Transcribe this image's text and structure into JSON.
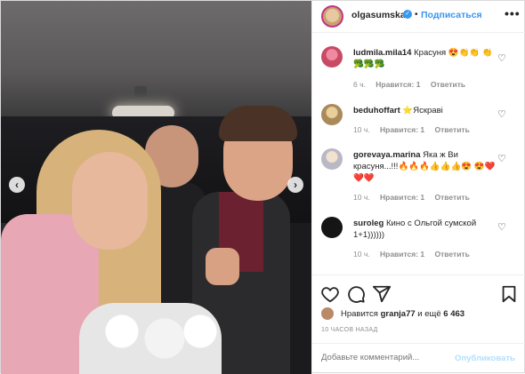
{
  "header": {
    "username": "olgasumska",
    "separator": "•",
    "follow_label": "Подписаться",
    "more_label": "•••"
  },
  "photo": {
    "prev_arrow": "‹",
    "next_arrow": "›"
  },
  "comments": [
    {
      "user": "ludmila.mila14",
      "text": "Красуня 😍👏👏 👏🥦🥦🥦",
      "time": "6 ч.",
      "likes": "Нравится: 1",
      "reply": "Ответить"
    },
    {
      "user": "beduhoffart",
      "text": "⭐Яскраві",
      "time": "10 ч.",
      "likes": "Нравится: 1",
      "reply": "Ответить"
    },
    {
      "user": "gorevaya.marina",
      "text": "Яка ж Ви красуня...!!!🔥🔥🔥👍👍👍😍 😍❤️❤️❤️",
      "time": "10 ч.",
      "likes": "Нравится: 1",
      "reply": "Ответить"
    },
    {
      "user": "suroleg",
      "text": "Кино с Ольгой сумской 1+1))))))",
      "time": "10 ч.",
      "likes": "Нравится: 1",
      "reply": "Ответить"
    }
  ],
  "likes": {
    "prefix": "Нравится",
    "user": "granja77",
    "suffix": "и ещё",
    "count": "6 463"
  },
  "timestamp": "10 ЧАСОВ НАЗАД",
  "add_comment": {
    "placeholder": "Добавьте комментарий...",
    "publish_label": "Опубликовать"
  },
  "colors": {
    "accent": "#3897f0",
    "publish_disabled": "#b2dffc",
    "muted": "#8e8e8e"
  }
}
